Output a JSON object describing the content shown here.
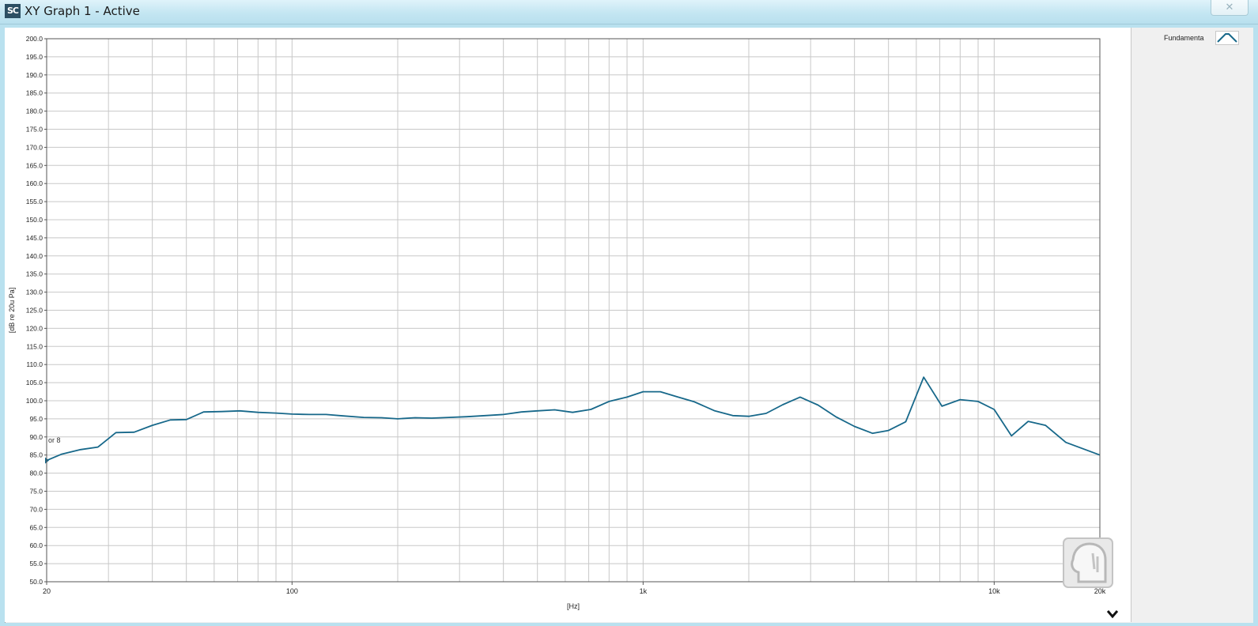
{
  "window": {
    "app_icon_text": "SC",
    "title": "XY Graph 1 - Active",
    "close_icon": "close-icon"
  },
  "legend": {
    "label": "Fundamenta"
  },
  "cursor_label": "or 8",
  "chart_data": {
    "type": "line",
    "xlabel": "[Hz]",
    "ylabel": "[dB re 20u Pa]",
    "x_scale": "log",
    "xlim": [
      20,
      20000
    ],
    "ylim": [
      50,
      200
    ],
    "x_tick_labels": [
      {
        "value": 20,
        "label": "20"
      },
      {
        "value": 100,
        "label": "100"
      },
      {
        "value": 1000,
        "label": "1k"
      },
      {
        "value": 10000,
        "label": "10k"
      },
      {
        "value": 20000,
        "label": "20k"
      }
    ],
    "y_ticks": [
      50.0,
      55.0,
      60.0,
      65.0,
      70.0,
      75.0,
      80.0,
      85.0,
      90.0,
      95.0,
      100.0,
      105.0,
      110.0,
      115.0,
      120.0,
      125.0,
      130.0,
      135.0,
      140.0,
      145.0,
      150.0,
      155.0,
      160.0,
      165.0,
      170.0,
      175.0,
      180.0,
      185.0,
      190.0,
      195.0,
      200.0
    ],
    "grid": true,
    "legend_position": "top-right",
    "series": [
      {
        "name": "Fundamenta",
        "color": "#17688a",
        "points": [
          [
            20,
            83.5
          ],
          [
            22,
            85.2
          ],
          [
            25,
            86.5
          ],
          [
            28,
            87.2
          ],
          [
            31.5,
            91.2
          ],
          [
            35.5,
            91.3
          ],
          [
            40,
            93.2
          ],
          [
            45,
            94.7
          ],
          [
            50,
            94.8
          ],
          [
            56,
            96.9
          ],
          [
            63,
            97.0
          ],
          [
            71,
            97.2
          ],
          [
            80,
            96.8
          ],
          [
            90,
            96.6
          ],
          [
            100,
            96.3
          ],
          [
            112,
            96.2
          ],
          [
            125,
            96.2
          ],
          [
            140,
            95.8
          ],
          [
            160,
            95.4
          ],
          [
            180,
            95.3
          ],
          [
            200,
            95.0
          ],
          [
            224,
            95.3
          ],
          [
            250,
            95.2
          ],
          [
            280,
            95.4
          ],
          [
            315,
            95.6
          ],
          [
            355,
            95.9
          ],
          [
            400,
            96.2
          ],
          [
            450,
            96.9
          ],
          [
            500,
            97.2
          ],
          [
            560,
            97.5
          ],
          [
            630,
            96.8
          ],
          [
            710,
            97.6
          ],
          [
            800,
            99.8
          ],
          [
            900,
            101.0
          ],
          [
            1000,
            102.5
          ],
          [
            1120,
            102.5
          ],
          [
            1250,
            101.1
          ],
          [
            1400,
            99.7
          ],
          [
            1600,
            97.2
          ],
          [
            1800,
            95.9
          ],
          [
            2000,
            95.7
          ],
          [
            2240,
            96.5
          ],
          [
            2500,
            98.9
          ],
          [
            2800,
            101.0
          ],
          [
            3150,
            98.8
          ],
          [
            3550,
            95.5
          ],
          [
            4000,
            92.9
          ],
          [
            4500,
            91.0
          ],
          [
            5000,
            91.8
          ],
          [
            5600,
            94.2
          ],
          [
            6300,
            106.5
          ],
          [
            7100,
            98.5
          ],
          [
            8000,
            100.3
          ],
          [
            9000,
            99.8
          ],
          [
            10000,
            97.6
          ],
          [
            11200,
            90.3
          ],
          [
            12500,
            94.3
          ],
          [
            14000,
            93.2
          ],
          [
            16000,
            88.5
          ],
          [
            20000,
            85.0
          ]
        ]
      }
    ]
  }
}
